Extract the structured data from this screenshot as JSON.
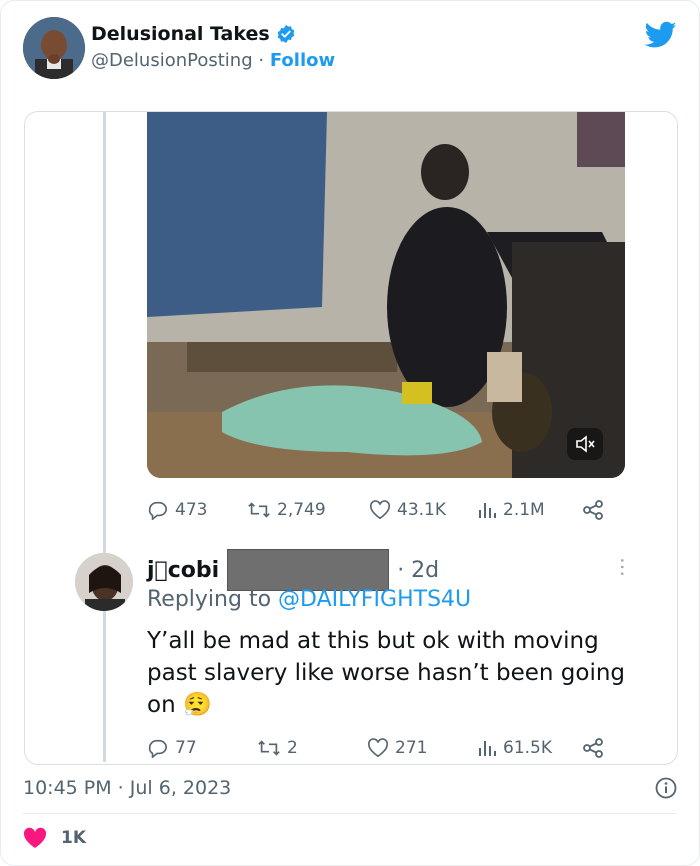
{
  "author": {
    "name": "Delusional Takes",
    "handle": "@DelusionPosting",
    "separator": "·",
    "follow_label": "Follow"
  },
  "quoted": {
    "media_icon": "speaker-muted-icon",
    "metrics": {
      "replies": "473",
      "retweets": "2,749",
      "likes": "43.1K",
      "views": "2.1M"
    }
  },
  "reply": {
    "name": "jcobi",
    "time": "· 2d",
    "replying_prefix": "Replying to",
    "replying_to": "@DAILYFIGHTS4U",
    "text": "Y’all be mad at this but ok with moving past slavery like worse hasn’t been going on",
    "emoji": "😮‍💨",
    "metrics": {
      "replies": "77",
      "retweets": "2",
      "likes": "271",
      "views": "61.5K"
    }
  },
  "footer": {
    "timestamp": "10:45 PM · Jul 6, 2023",
    "likes": "1K"
  },
  "colors": {
    "accent": "#1d9bf0",
    "like": "#f91880",
    "muted": "#536471"
  }
}
